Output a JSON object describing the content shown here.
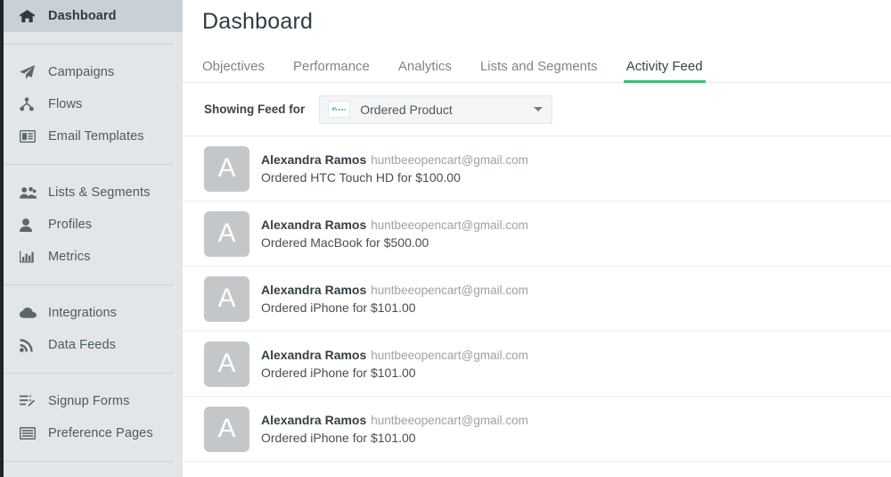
{
  "theme": {
    "sidebar_bg": "#e2e6e8",
    "sidebar_active_bg": "#c9d1d6",
    "accent_green": "#3cbc77",
    "avatar_bg": "#c4c7c9",
    "text_dark": "#333f46",
    "text_muted": "#9aa3a8"
  },
  "sidebar": {
    "groups": [
      {
        "items": [
          {
            "label": "Dashboard",
            "icon": "home-icon",
            "active": true
          }
        ]
      },
      {
        "items": [
          {
            "label": "Campaigns",
            "icon": "paper-plane-icon",
            "active": false
          },
          {
            "label": "Flows",
            "icon": "flow-node-icon",
            "active": false
          },
          {
            "label": "Email Templates",
            "icon": "email-template-icon",
            "active": false
          }
        ]
      },
      {
        "items": [
          {
            "label": "Lists & Segments",
            "icon": "users-group-icon",
            "active": false
          },
          {
            "label": "Profiles",
            "icon": "person-icon",
            "active": false
          },
          {
            "label": "Metrics",
            "icon": "bar-chart-icon",
            "active": false
          }
        ]
      },
      {
        "items": [
          {
            "label": "Integrations",
            "icon": "cloud-icon",
            "active": false
          },
          {
            "label": "Data Feeds",
            "icon": "rss-feed-icon",
            "active": false
          }
        ]
      },
      {
        "items": [
          {
            "label": "Signup Forms",
            "icon": "signup-form-icon",
            "active": false
          },
          {
            "label": "Preference Pages",
            "icon": "preference-page-icon",
            "active": false
          }
        ]
      }
    ]
  },
  "main": {
    "page_title": "Dashboard",
    "tabs": [
      {
        "label": "Objectives",
        "active": false
      },
      {
        "label": "Performance",
        "active": false
      },
      {
        "label": "Analytics",
        "active": false
      },
      {
        "label": "Lists and Segments",
        "active": false
      },
      {
        "label": "Activity Feed",
        "active": true
      }
    ],
    "filter": {
      "label": "Showing Feed for",
      "selected_value": "Ordered Product",
      "logo_icon": "integration-logo-icon",
      "caret_icon": "chevron-down-icon"
    },
    "feed": {
      "rows": [
        {
          "avatar_initial": "A",
          "name": "Alexandra Ramos",
          "email": "huntbeeopencart@gmail.com",
          "description": "Ordered HTC Touch HD for $100.00"
        },
        {
          "avatar_initial": "A",
          "name": "Alexandra Ramos",
          "email": "huntbeeopencart@gmail.com",
          "description": "Ordered MacBook for $500.00"
        },
        {
          "avatar_initial": "A",
          "name": "Alexandra Ramos",
          "email": "huntbeeopencart@gmail.com",
          "description": "Ordered iPhone for $101.00"
        },
        {
          "avatar_initial": "A",
          "name": "Alexandra Ramos",
          "email": "huntbeeopencart@gmail.com",
          "description": "Ordered iPhone for $101.00"
        },
        {
          "avatar_initial": "A",
          "name": "Alexandra Ramos",
          "email": "huntbeeopencart@gmail.com",
          "description": "Ordered iPhone for $101.00"
        }
      ]
    }
  }
}
